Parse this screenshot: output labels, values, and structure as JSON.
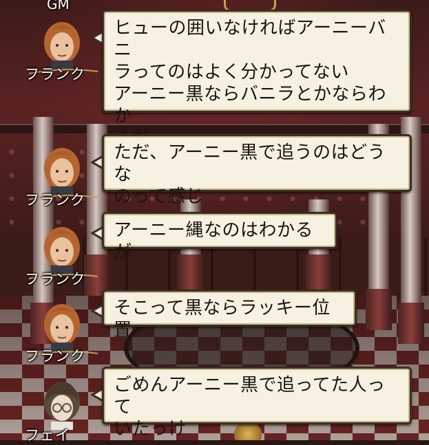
{
  "top_label": "GM",
  "messages": [
    {
      "speaker": "フランク",
      "avatar": "frank-portrait",
      "text": "ヒューの囲いなければアーニーバニ\nラってのはよく分かってない\nアーニー黒ならバニラとかならわか\nるが"
    },
    {
      "speaker": "フランク",
      "avatar": "frank-portrait",
      "text": "ただ、アーニー黒で追うのはどうな\nのって感じ"
    },
    {
      "speaker": "フランク",
      "avatar": "frank-portrait",
      "text": "アーニー縄なのはわかるが"
    },
    {
      "speaker": "フランク",
      "avatar": "frank-portrait",
      "text": "そこって黒ならラッキー位置"
    },
    {
      "speaker": "フェイ",
      "avatar": "fay-portrait",
      "text": "ごめんアーニー黒で追ってた人って\nいたっけ"
    }
  ],
  "colors": {
    "bubble_bg": "#f6f1e0",
    "bubble_border": "#3a2e22",
    "text": "#1b1511",
    "name_text": "#ffffff"
  }
}
